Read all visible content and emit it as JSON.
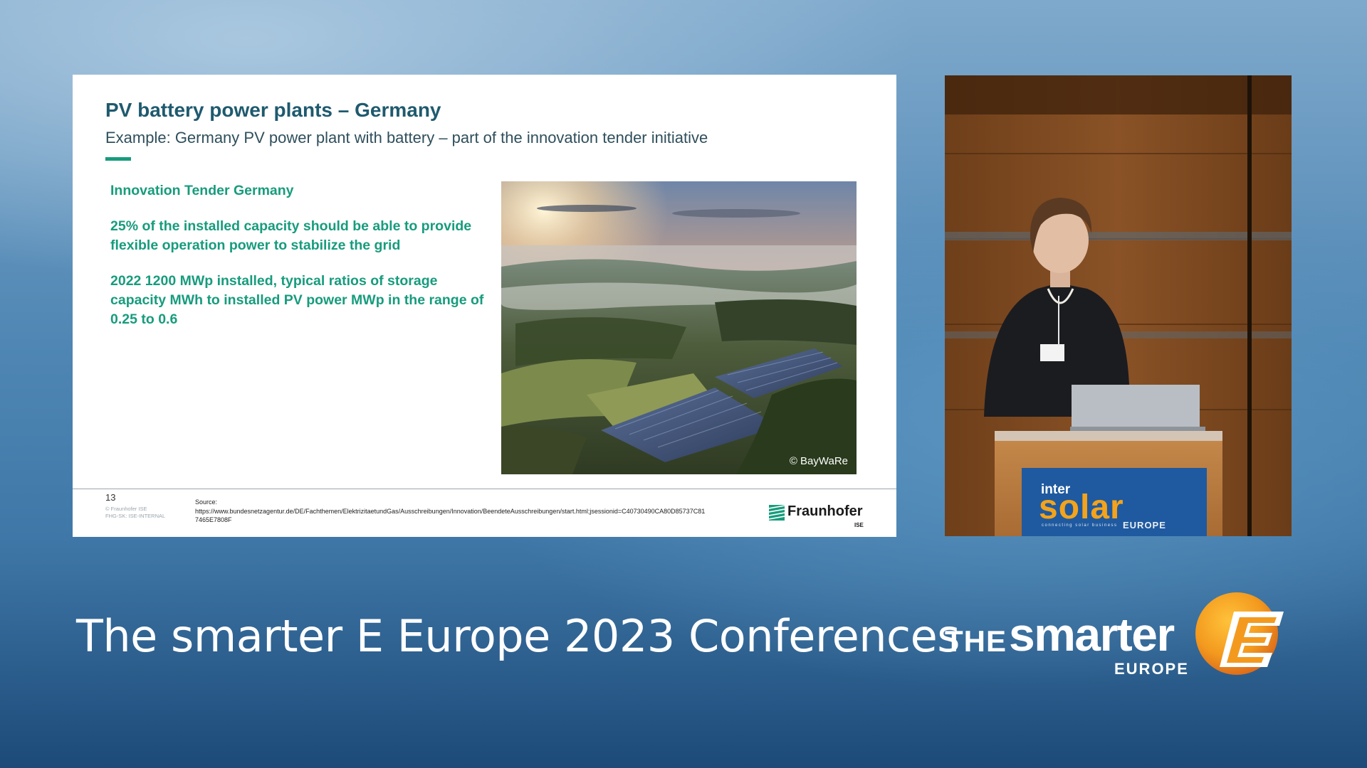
{
  "slide": {
    "title": "PV battery power plants – Germany",
    "subtitle": "Example: Germany PV power plant with battery – part of the innovation tender initiative",
    "bullets": [
      "Innovation Tender Germany",
      "25% of the installed capacity should be able to provide flexible operation power to stabilize the grid",
      "2022 1200 MWp installed, typical ratios of storage capacity MWh to installed PV power MWp in the range of 0.25 to 0.6"
    ],
    "image_credit": "© BayWaRe",
    "page_number": "13",
    "footer_copyright": "© Fraunhofer ISE",
    "footer_classification": "FHG-SK: ISE-INTERNAL",
    "source_label": "Source:",
    "source_url": "https://www.bundesnetzagentur.de/DE/Fachthemen/ElektrizitaetundGas/Ausschreibungen/Innovation/BeendeteAusschreibungen/start.html;jsessionid=C40730490CA80D85737C817465E7808F",
    "logo_name": "Fraunhofer",
    "logo_sub": "ISE"
  },
  "podium": {
    "inter": "inter",
    "solar": "solar",
    "tagline": "connecting solar business",
    "region": "EUROPE"
  },
  "banner": {
    "conference_title": "The smarter E Europe 2023 Conferences",
    "brand_the": "THE",
    "brand_smarter": "smarter",
    "brand_region": "EUROPE"
  },
  "colors": {
    "slide_title": "#1f5a6e",
    "accent_green": "#179c7d",
    "brand_orange": "#f39a1e",
    "background_blue": "#4f86b3"
  },
  "icons": [
    "fraunhofer-logo-icon",
    "smarter-e-logo-icon"
  ]
}
